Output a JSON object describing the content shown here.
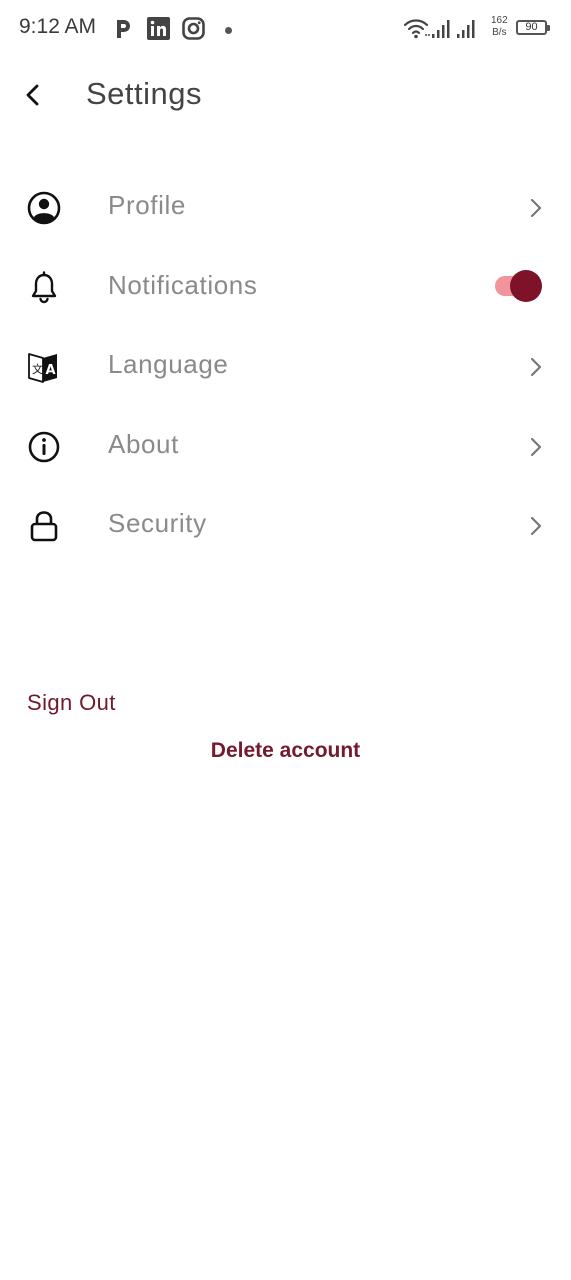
{
  "status_bar": {
    "time": "9:12 AM",
    "net_speed_value": "162",
    "net_speed_unit": "B/s",
    "battery": "90",
    "icons": [
      "pinterest-icon",
      "linkedin-icon",
      "instagram-icon",
      "wifi-icon",
      "signal-icon"
    ]
  },
  "header": {
    "title": "Settings",
    "back_icon": "chevron-left-icon"
  },
  "settings": {
    "items": [
      {
        "label": "Profile",
        "icon": "user-circle-icon",
        "control": "chevron"
      },
      {
        "label": "Notifications",
        "icon": "bell-icon",
        "control": "toggle",
        "toggle_on": true
      },
      {
        "label": "Language",
        "icon": "translate-icon",
        "control": "chevron"
      },
      {
        "label": "About",
        "icon": "info-icon",
        "control": "chevron"
      },
      {
        "label": "Security",
        "icon": "lock-icon",
        "control": "chevron"
      }
    ]
  },
  "actions": {
    "sign_out": "Sign Out",
    "delete_account": "Delete account"
  },
  "colors": {
    "accent": "#7d1228",
    "toggle_track": "#f0959b",
    "label_text": "#8a8a8a",
    "sign_out": "#6e1a2c"
  }
}
